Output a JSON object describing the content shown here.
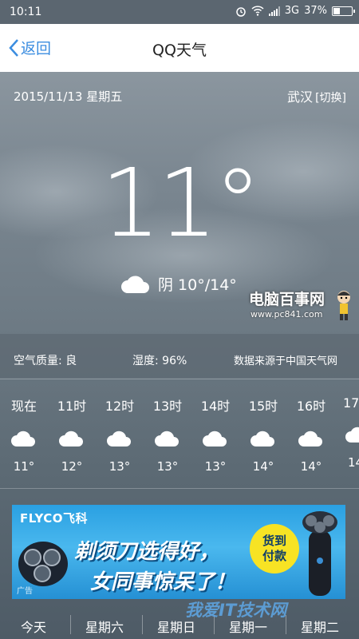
{
  "status_bar": {
    "time": "10:11",
    "network": "3G",
    "battery": "37%"
  },
  "header": {
    "back_label": "返回",
    "title": "QQ天气"
  },
  "weather": {
    "date": "2015/11/13 星期五",
    "city": "武汉",
    "switch_label": "[切换]",
    "temperature": "11°",
    "condition": "阴 10°/14°"
  },
  "details": {
    "air_quality": "空气质量: 良",
    "humidity": "湿度: 96%",
    "source": "数据来源于中国天气网"
  },
  "hourly": [
    {
      "label": "现在",
      "temp": "11°"
    },
    {
      "label": "11时",
      "temp": "12°"
    },
    {
      "label": "12时",
      "temp": "13°"
    },
    {
      "label": "13时",
      "temp": "13°"
    },
    {
      "label": "14时",
      "temp": "13°"
    },
    {
      "label": "15时",
      "temp": "14°"
    },
    {
      "label": "16时",
      "temp": "14°"
    },
    {
      "label": "17",
      "temp": "14"
    }
  ],
  "ad": {
    "brand": "FLYCO飞科",
    "line1": "剃须刀选得好，",
    "line2": "女同事惊呆了！",
    "badge_line1": "货到",
    "badge_line2": "付款",
    "tag": "广告"
  },
  "day_tabs": [
    "今天",
    "星期六",
    "星期日",
    "星期一",
    "星期二"
  ],
  "watermarks": {
    "site_name": "电脑百事网",
    "site_url": "www.pc841.com",
    "bottom": "我爱IT技术网"
  },
  "colors": {
    "accent": "#3b8de0",
    "ad_bg": "#2aa0e2",
    "badge": "#f7e324"
  }
}
